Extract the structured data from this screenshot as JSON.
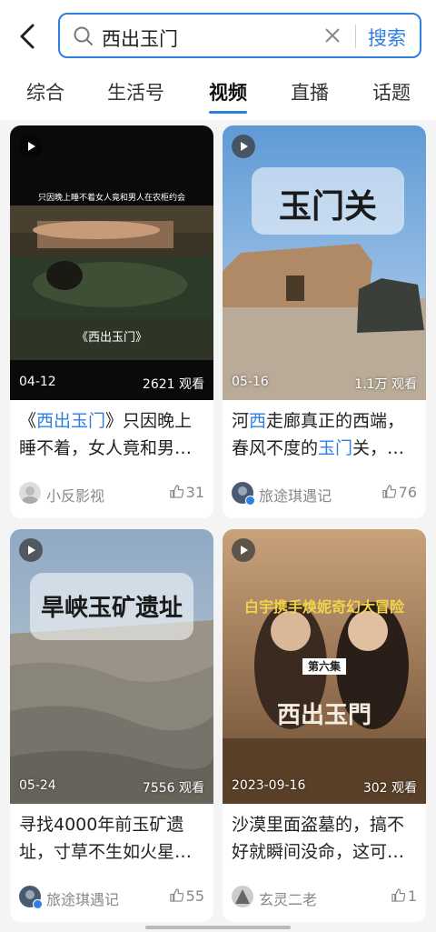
{
  "search": {
    "query": "西出玉门",
    "button_label": "搜索"
  },
  "tabs": [
    {
      "label": "综合"
    },
    {
      "label": "生活号"
    },
    {
      "label": "视频"
    },
    {
      "label": "直播"
    },
    {
      "label": "话题"
    }
  ],
  "active_tab": "视频",
  "cards": [
    {
      "date": "04-12",
      "views": "2621 观看",
      "title_pre": "《",
      "title_hl": "西出玉门",
      "title_post": "》只因晚上睡不着，女人竟和男…",
      "author": "小反影视",
      "likes": "31",
      "thumb_caption_top": "只因晚上睡不着女人竟和男人在农柜约会",
      "thumb_caption_bottom": "《西出玉门》"
    },
    {
      "date": "05-16",
      "views": "1.1万 观看",
      "title_pre": "河",
      "title_hl": "西",
      "title_mid": "走廊真正的西端，春风不度的",
      "title_hl2": "玉门",
      "title_post": "关，…",
      "author": "旅途琪遇记",
      "likes": "76",
      "thumb_big_text": "玉门关"
    },
    {
      "date": "05-24",
      "views": "7556 观看",
      "title": "寻找4000年前玉矿遗址，寸草不生如火星…",
      "author": "旅途琪遇记",
      "likes": "55",
      "thumb_big_text": "旱峡玉矿遗址"
    },
    {
      "date": "2023-09-16",
      "views": "302 观看",
      "title": "沙漠里面盗墓的，搞不好就瞬间没命，这可…",
      "author": "玄灵二老",
      "likes": "1",
      "thumb_banner": "白宇携手焕妮奇幻大冒险",
      "thumb_episode": "第六集",
      "thumb_logo": "西出玉門"
    }
  ],
  "colors": {
    "accent": "#2f7fe0",
    "background": "#f4f4f4"
  },
  "icons": [
    "back-arrow-icon",
    "search-icon",
    "clear-icon",
    "play-icon",
    "thumbs-up-icon",
    "verified-icon"
  ]
}
